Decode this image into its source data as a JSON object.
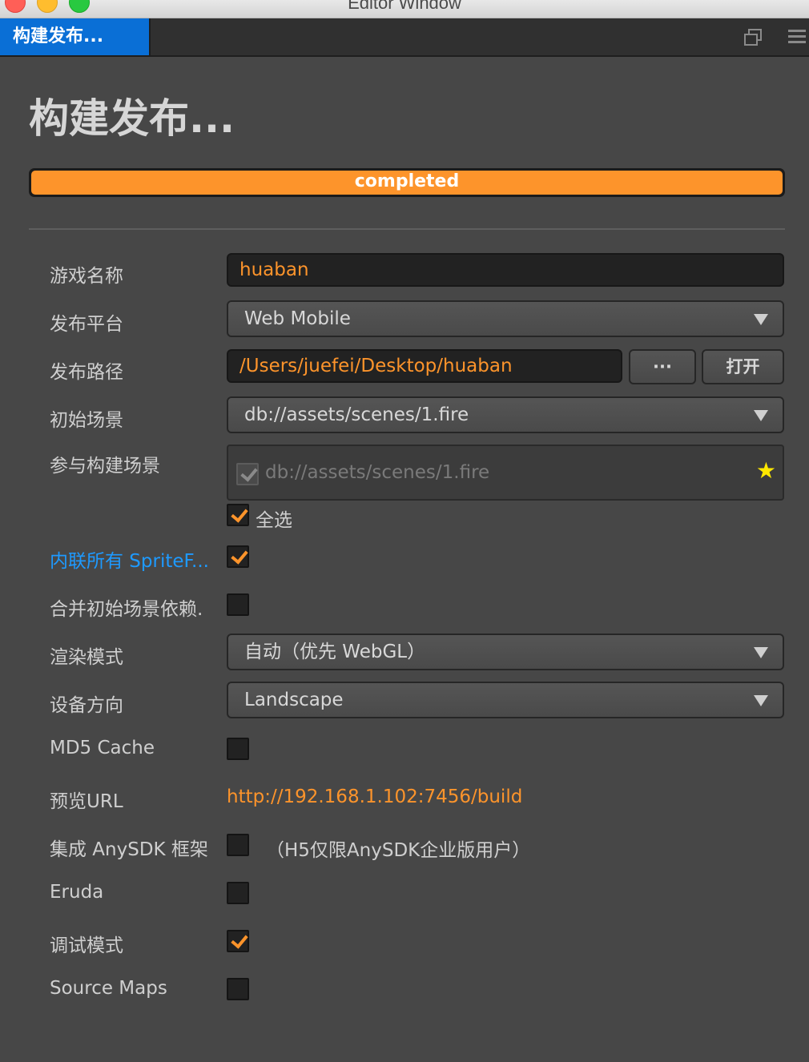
{
  "window": {
    "title": "Editor Window"
  },
  "tab": {
    "label": "构建发布..."
  },
  "page": {
    "title": "构建发布..."
  },
  "progress": {
    "label": "completed",
    "value": 1.0,
    "color": "#fd942b"
  },
  "form": {
    "game_name": {
      "label": "游戏名称",
      "value": "huaban"
    },
    "platform": {
      "label": "发布平台",
      "value": "Web Mobile"
    },
    "build_path": {
      "label": "发布路径",
      "value": "/Users/juefei/Desktop/huaban",
      "browse_label": "···",
      "open_label": "打开"
    },
    "start_scene": {
      "label": "初始场景",
      "value": "db://assets/scenes/1.fire"
    },
    "included_scenes": {
      "label": "参与构建场景",
      "items": [
        {
          "path": "db://assets/scenes/1.fire",
          "checked": true,
          "is_start": true
        }
      ],
      "select_all_label": "全选",
      "select_all_checked": true
    },
    "inline_sprite_frames": {
      "label": "内联所有 SpriteF...",
      "checked": true
    },
    "merge_start_scene": {
      "label": "合并初始场景依赖.",
      "checked": false
    },
    "render_mode": {
      "label": "渲染模式",
      "value": "自动（优先 WebGL）"
    },
    "orientation": {
      "label": "设备方向",
      "value": "Landscape"
    },
    "md5_cache": {
      "label": "MD5 Cache",
      "checked": false
    },
    "preview_url": {
      "label": "预览URL",
      "value": "http://192.168.1.102:7456/build"
    },
    "anysdk": {
      "label": "集成 AnySDK 框架",
      "checked": false,
      "note": "（H5仅限AnySDK企业版用户）"
    },
    "eruda": {
      "label": "Eruda",
      "checked": false
    },
    "debug": {
      "label": "调试模式",
      "checked": true
    },
    "source_maps": {
      "label": "Source Maps",
      "checked": false
    }
  },
  "colors": {
    "accent": "#fd942b",
    "link": "#1e9aff",
    "tab_active": "#0a6fd6",
    "background": "#474747"
  }
}
